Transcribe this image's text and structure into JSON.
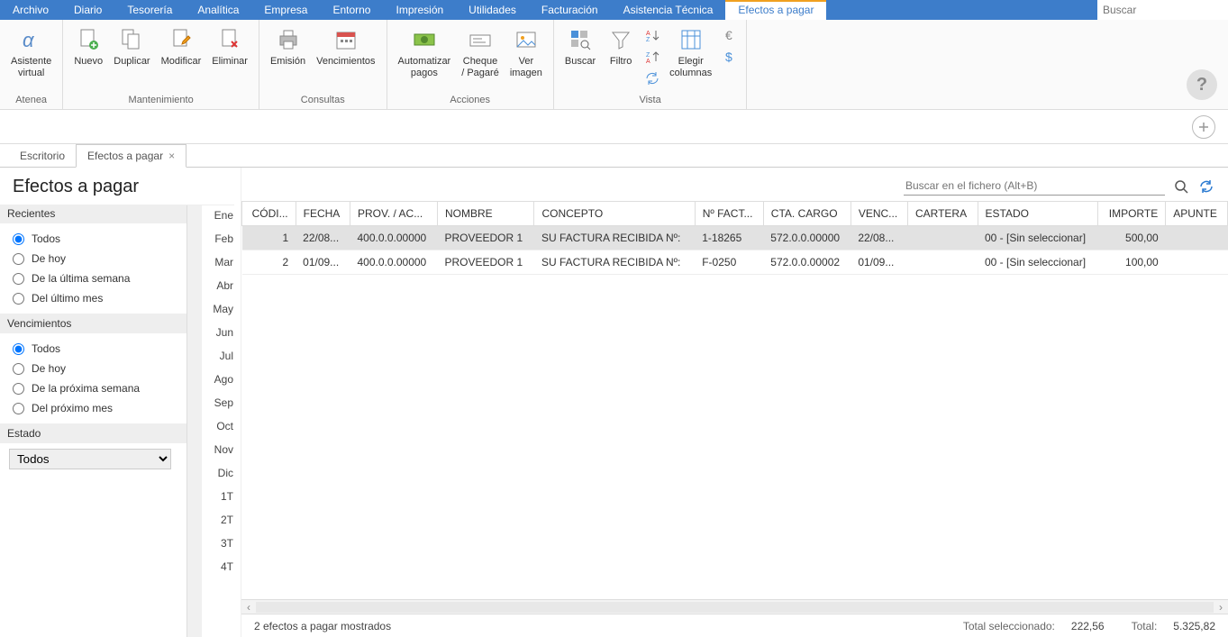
{
  "menubar": {
    "items": [
      "Archivo",
      "Diario",
      "Tesorería",
      "Analítica",
      "Empresa",
      "Entorno",
      "Impresión",
      "Utilidades",
      "Facturación",
      "Asistencia Técnica",
      "Efectos a pagar"
    ],
    "active_index": 10,
    "search_placeholder": "Buscar"
  },
  "ribbon": {
    "groups": [
      {
        "label": "Atenea",
        "buttons": [
          {
            "name": "asistente-virtual",
            "label": "Asistente\nvirtual",
            "icon": "alpha"
          }
        ]
      },
      {
        "label": "Mantenimiento",
        "buttons": [
          {
            "name": "nuevo",
            "label": "Nuevo",
            "icon": "doc-plus"
          },
          {
            "name": "duplicar",
            "label": "Duplicar",
            "icon": "doc-copy"
          },
          {
            "name": "modificar",
            "label": "Modificar",
            "icon": "doc-edit"
          },
          {
            "name": "eliminar",
            "label": "Eliminar",
            "icon": "doc-delete"
          }
        ]
      },
      {
        "label": "Consultas",
        "buttons": [
          {
            "name": "emision",
            "label": "Emisión",
            "icon": "printer"
          },
          {
            "name": "vencimientos",
            "label": "Vencimientos",
            "icon": "calendar"
          }
        ]
      },
      {
        "label": "Acciones",
        "buttons": [
          {
            "name": "automatizar-pagos",
            "label": "Automatizar\npagos",
            "icon": "money"
          },
          {
            "name": "cheque-pagare",
            "label": "Cheque\n/ Pagaré",
            "icon": "cheque"
          },
          {
            "name": "ver-imagen",
            "label": "Ver\nimagen",
            "icon": "image"
          }
        ]
      },
      {
        "label": "Vista",
        "buttons": [
          {
            "name": "buscar",
            "label": "Buscar",
            "icon": "search"
          },
          {
            "name": "filtro",
            "label": "Filtro",
            "icon": "funnel"
          }
        ],
        "small_buttons": [
          {
            "name": "sort-asc",
            "icon": "sort-asc"
          },
          {
            "name": "sort-desc",
            "icon": "sort-desc"
          },
          {
            "name": "refresh",
            "icon": "refresh"
          }
        ],
        "extra": [
          {
            "name": "elegir-columnas",
            "label": "Elegir\ncolumnas",
            "icon": "columns"
          }
        ],
        "currency": [
          {
            "name": "euro",
            "icon": "euro"
          },
          {
            "name": "dollar",
            "icon": "dollar"
          }
        ]
      }
    ]
  },
  "tabs": {
    "items": [
      {
        "label": "Escritorio",
        "closable": false
      },
      {
        "label": "Efectos a pagar",
        "closable": true
      }
    ],
    "active_index": 1
  },
  "page": {
    "title": "Efectos a pagar"
  },
  "sidebar": {
    "groups": [
      {
        "header": "Recientes",
        "name": "recientes",
        "options": [
          "Todos",
          "De hoy",
          "De la última semana",
          "Del último mes"
        ],
        "selected": 0
      },
      {
        "header": "Vencimientos",
        "name": "vencimientos-filter",
        "options": [
          "Todos",
          "De hoy",
          "De la próxima semana",
          "Del próximo mes"
        ],
        "selected": 0
      }
    ],
    "estado": {
      "header": "Estado",
      "value": "Todos"
    }
  },
  "months": [
    "Ene",
    "Feb",
    "Mar",
    "Abr",
    "May",
    "Jun",
    "Jul",
    "Ago",
    "Sep",
    "Oct",
    "Nov",
    "Dic",
    "1T",
    "2T",
    "3T",
    "4T"
  ],
  "search_file": {
    "placeholder": "Buscar en el fichero (Alt+B)"
  },
  "grid": {
    "columns": [
      "CÓDI...",
      "FECHA",
      "PROV. / AC...",
      "NOMBRE",
      "CONCEPTO",
      "Nº FACT...",
      "CTA. CARGO",
      "VENC...",
      "CARTERA",
      "ESTADO",
      "IMPORTE",
      "APUNTE"
    ],
    "rows": [
      {
        "codigo": "1",
        "fecha": "22/08...",
        "prov": "400.0.0.00000",
        "nombre": "PROVEEDOR 1",
        "concepto": "SU FACTURA RECIBIDA Nº:",
        "nfact": "1-18265",
        "ctacargo": "572.0.0.00000",
        "venc": "22/08...",
        "cartera": "",
        "estado": "00 - [Sin seleccionar]",
        "importe": "500,00",
        "apunte": "",
        "selected": true
      },
      {
        "codigo": "2",
        "fecha": "01/09...",
        "prov": "400.0.0.00000",
        "nombre": "PROVEEDOR 1",
        "concepto": "SU FACTURA RECIBIDA Nº:",
        "nfact": "F-0250",
        "ctacargo": "572.0.0.00002",
        "venc": "01/09...",
        "cartera": "",
        "estado": "00 - [Sin seleccionar]",
        "importe": "100,00",
        "apunte": "",
        "selected": false
      }
    ]
  },
  "statusbar": {
    "count_text": "2 efectos a pagar mostrados",
    "total_sel_label": "Total seleccionado:",
    "total_sel_value": "222,56",
    "total_label": "Total:",
    "total_value": "5.325,82"
  }
}
